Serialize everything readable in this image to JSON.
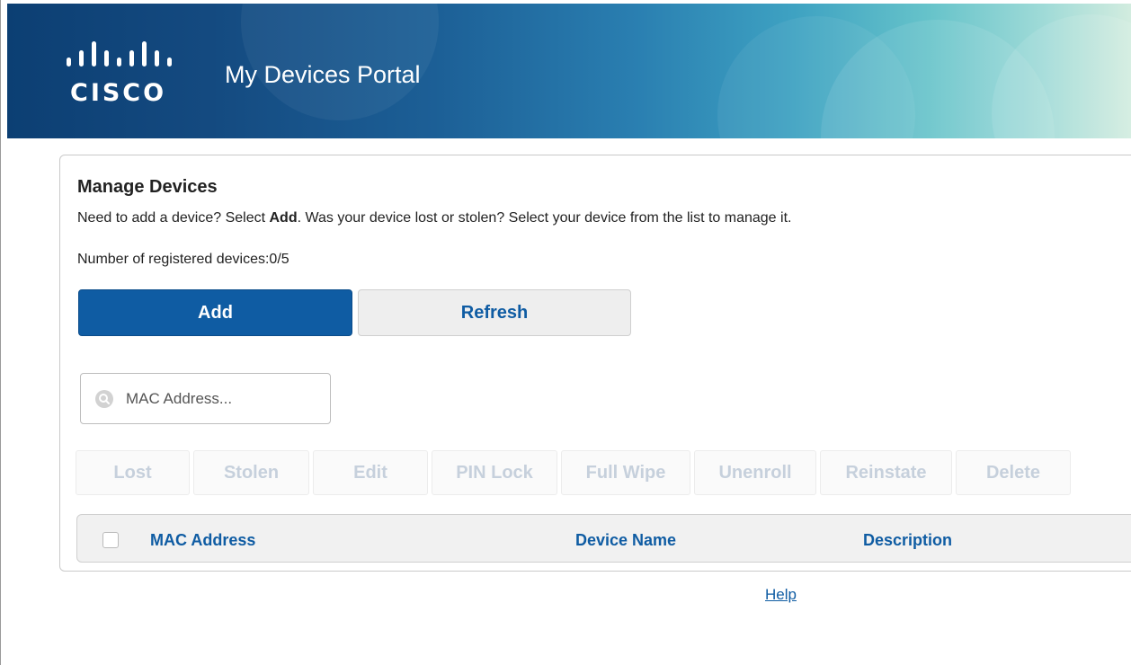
{
  "header": {
    "logo_text": "CISCO",
    "portal_title": "My Devices Portal"
  },
  "manage": {
    "title": "Manage Devices",
    "desc_prefix": "Need to add a device? Select ",
    "desc_bold": "Add",
    "desc_suffix": ". Was your device lost or stolen? Select your device from the list to manage it.",
    "count_text": "Number of registered devices:0/5"
  },
  "buttons": {
    "add_label": "Add",
    "refresh_label": "Refresh"
  },
  "search": {
    "placeholder": "MAC Address...",
    "value": ""
  },
  "actions": [
    {
      "label": "Lost"
    },
    {
      "label": "Stolen"
    },
    {
      "label": "Edit"
    },
    {
      "label": "PIN Lock"
    },
    {
      "label": "Full Wipe"
    },
    {
      "label": "Unenroll"
    },
    {
      "label": "Reinstate"
    },
    {
      "label": "Delete"
    }
  ],
  "table": {
    "columns": [
      "MAC Address",
      "Device Name",
      "Description"
    ]
  },
  "footer": {
    "help_label": "Help"
  },
  "colors": {
    "primary": "#0f5ca3",
    "disabled_text": "#c6d0dc",
    "header_dark": "#0c3f73",
    "header_light": "#d2ecdf"
  }
}
